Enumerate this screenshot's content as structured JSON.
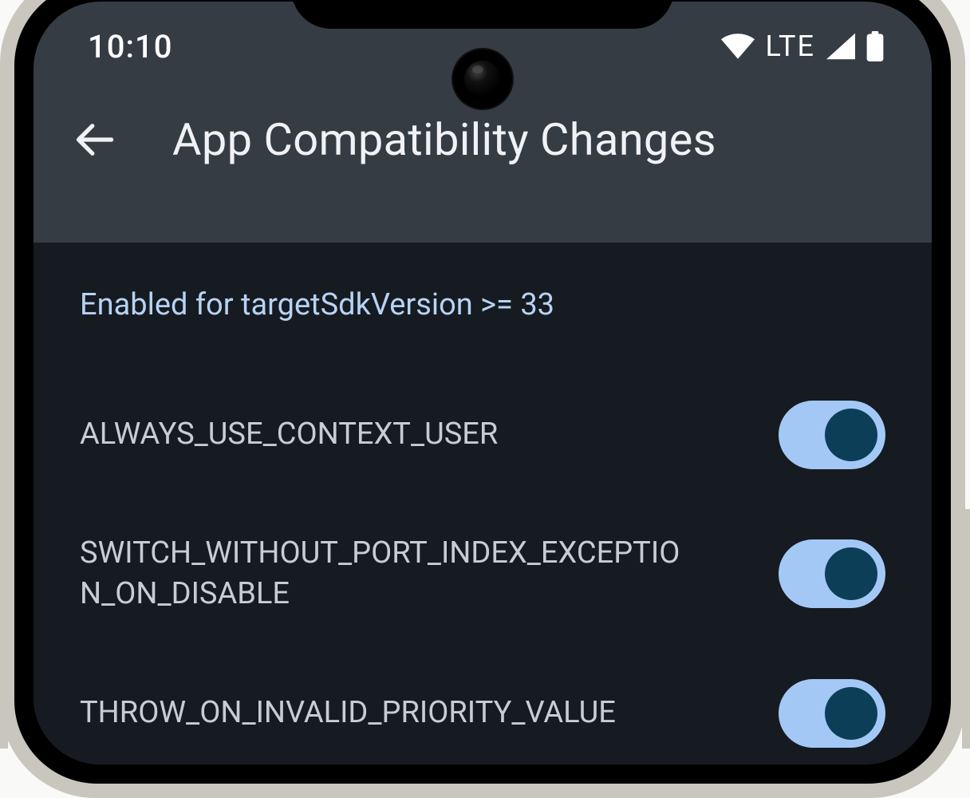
{
  "statusbar": {
    "time": "10:10",
    "network_label": "LTE"
  },
  "appbar": {
    "title": "App Compatibility Changes"
  },
  "section": {
    "header": "Enabled for targetSdkVersion >= 33"
  },
  "rows": [
    {
      "label": "ALWAYS_USE_CONTEXT_USER",
      "enabled": true
    },
    {
      "label": "SWITCH_WITHOUT_PORT_INDEX_EXCEPTION_ON_DISABLE",
      "enabled": true
    },
    {
      "label": "THROW_ON_INVALID_PRIORITY_VALUE",
      "enabled": true
    }
  ]
}
